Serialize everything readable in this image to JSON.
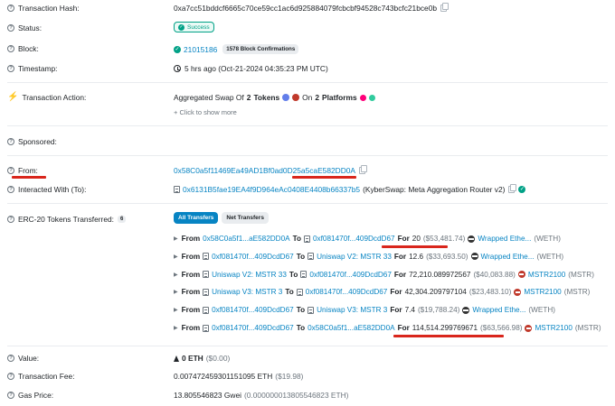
{
  "tx_hash": {
    "label": "Transaction Hash:",
    "value": "0xa7cc51bddcf6665c70ce59cc1ac6d925884079fcbcbf94528c743bcfc21bce0b"
  },
  "status": {
    "label": "Status:",
    "value": "Success"
  },
  "block": {
    "label": "Block:",
    "number": "21015186",
    "confirmations": "1578 Block Confirmations"
  },
  "timestamp": {
    "label": "Timestamp:",
    "value": "5 hrs ago (Oct-21-2024 04:35:23 PM UTC)"
  },
  "action": {
    "label": "Transaction Action:",
    "prefix": "Aggregated Swap Of",
    "count": "2",
    "tokens_word": "Tokens",
    "on_word": "On",
    "platforms_count": "2",
    "platforms_word": "Platforms",
    "show_more": "+ Click to show more"
  },
  "sponsored": {
    "label": "Sponsored:"
  },
  "from": {
    "label": "From:",
    "address": "0x58C0a5f11469Ea49AD1Bf0ad0D25a5caE582DD0A"
  },
  "interacted": {
    "label": "Interacted With (To):",
    "address": "0x6131B5fae19EA4f9D964eAc0408E4408b66337b5",
    "name": "(KyberSwap: Meta Aggregation Router v2)"
  },
  "erc20": {
    "label": "ERC-20 Tokens Transferred:",
    "count": "6",
    "tab_all": "All Transfers",
    "tab_net": "Net Transfers",
    "words": {
      "from": "From",
      "to": "To",
      "for": "For"
    },
    "transfers": [
      {
        "from": "0x58C0a5f1...aE582DD0A",
        "to": "0xf081470f...409DcdD67",
        "amount": "20",
        "usd": "($53,481.74)",
        "token": "Wrapped Ethe...",
        "symbol": "(WETH)",
        "from_contract": false,
        "to_contract": true
      },
      {
        "from": "0xf081470f...409DcdD67",
        "to": "Uniswap V2: MSTR 33",
        "amount": "12.6",
        "usd": "($33,693.50)",
        "token": "Wrapped Ethe...",
        "symbol": "(WETH)",
        "from_contract": true,
        "to_contract": true
      },
      {
        "from": "Uniswap V2: MSTR 33",
        "to": "0xf081470f...409DcdD67",
        "amount": "72,210.089972567",
        "usd": "($40,083.88)",
        "token": "MSTR2100",
        "symbol": "(MSTR)",
        "from_contract": true,
        "to_contract": true
      },
      {
        "from": "Uniswap V3: MSTR 3",
        "to": "0xf081470f...409DcdD67",
        "amount": "42,304.209797104",
        "usd": "($23,483.10)",
        "token": "MSTR2100",
        "symbol": "(MSTR)",
        "from_contract": true,
        "to_contract": true
      },
      {
        "from": "0xf081470f...409DcdD67",
        "to": "Uniswap V3: MSTR 3",
        "amount": "7.4",
        "usd": "($19,788.24)",
        "token": "Wrapped Ethe...",
        "symbol": "(WETH)",
        "from_contract": true,
        "to_contract": true
      },
      {
        "from": "0xf081470f...409DcdD67",
        "to": "0x58C0a5f1...aE582DD0A",
        "amount": "114,514.299769671",
        "usd": "($63,566.98)",
        "token": "MSTR2100",
        "symbol": "(MSTR)",
        "from_contract": true,
        "to_contract": false
      }
    ]
  },
  "value": {
    "label": "Value:",
    "amount": "0 ETH",
    "usd": "($0.00)"
  },
  "fee": {
    "label": "Transaction Fee:",
    "value": "0.007472459301151095 ETH",
    "usd": "($19.98)"
  },
  "gas": {
    "label": "Gas Price:",
    "value": "13.805546823 Gwei",
    "eth": "(0.000000013805546823 ETH)"
  },
  "colors": {
    "link": "#0784c3",
    "success": "#00a186",
    "annotation": "#d9261c"
  }
}
